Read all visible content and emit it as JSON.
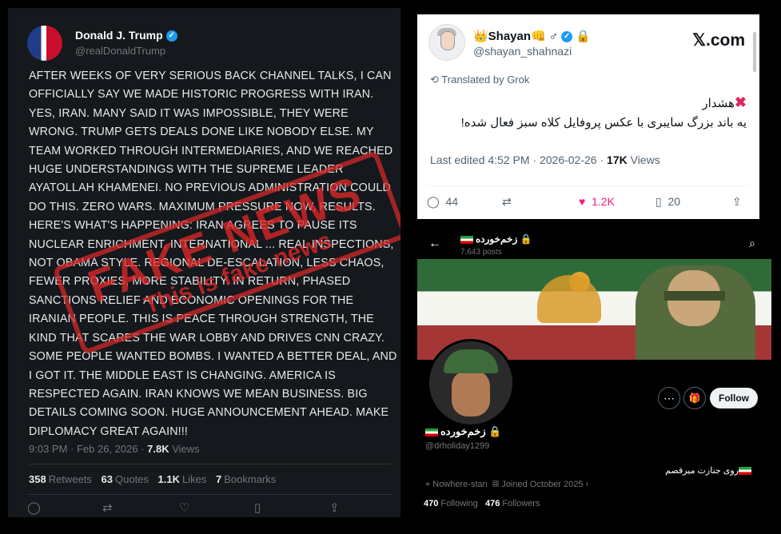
{
  "trump": {
    "name": "Donald J. Trump",
    "handle": "@realDonaldTrump",
    "text": "AFTER WEEKS OF VERY SERIOUS BACK CHANNEL TALKS, I CAN OFFICIALLY SAY WE MADE HISTORIC PROGRESS WITH IRAN. YES, IRAN. MANY SAID IT WAS IMPOSSIBLE, THEY WERE WRONG. TRUMP GETS DEALS DONE LIKE NOBODY ELSE. MY TEAM WORKED THROUGH INTERMEDIARIES, AND WE REACHED HUGE UNDERSTANDINGS WITH THE SUPREME LEADER AYATOLLAH KHAMENEI. NO PREVIOUS ADMINISTRATION COULD DO THIS. ZERO WARS. MAXIMUM PRESSURE NOW, RESULTS. HERE'S WHAT'S HAPPENING: IRAN AGREES TO PAUSE ITS NUCLEAR ENRICHMENT, INTERNATIONAL ... REAL INSPECTIONS, NOT OBAMA STYLE. REGIONAL DE-ESCALATION, LESS CHAOS, FEWER PROXIES, MORE STABILITY. IN RETURN, PHASED SANCTIONS RELIEF AND ECONOMIC OPENINGS FOR THE IRANIAN PEOPLE. THIS IS PEACE THROUGH STRENGTH, THE KIND THAT SCARES THE WAR LOBBY AND DRIVES CNN CRAZY. SOME PEOPLE WANTED BOMBS. I WANTED A BETTER DEAL, AND I GOT IT. THE MIDDLE EAST IS CHANGING. AMERICA IS RESPECTED AGAIN. IRAN KNOWS WE MEAN BUSINESS. BIG DETAILS COMING SOON. HUGE ANNOUNCEMENT AHEAD. MAKE DIPLOMACY GREAT AGAIN!!!",
    "time": "9:03 PM · Feb 26, 2026 · ",
    "views_count": "7.8K",
    "views_label": "Views",
    "retweets_count": "358",
    "retweets_label": "Retweets",
    "quotes_count": "63",
    "quotes_label": "Quotes",
    "likes_count": "1.1K",
    "likes_label": "Likes",
    "bookmarks_count": "7",
    "bookmarks_label": "Bookmarks"
  },
  "stamp": {
    "big": "FAKE NEWS",
    "small": "This is fake news"
  },
  "shayan": {
    "name": "👑Shayan👊 ♂",
    "handle": "@shayan_shahnazi",
    "site": "𝕏.com",
    "translated": "Translated by Grok",
    "line1": "هشدار",
    "line2": "یه باند بزرگ سایبری با عکس پروفایل کلاه سبز فعال شده!",
    "edited": "Last edited 4:52 PM · 2026-02-26 · ",
    "views_count": "17K",
    "views_label": "Views",
    "replies": "44",
    "likes": "1.2K",
    "bookmarks": "20"
  },
  "profile": {
    "title": "زخم‌خورده",
    "posts": "7,643 posts",
    "follow": "Follow",
    "name": "زخم‌خورده",
    "handle": "@drholiday1299",
    "bio": "روی جنازت میرقصم",
    "location": "Nowhere-stan",
    "joined": "Joined October 2025",
    "following_count": "470",
    "following_label": "Following",
    "followers_count": "476",
    "followers_label": "Followers"
  },
  "colors": {
    "twitter_blue": "#1d9bf0",
    "like_pink": "#f91880",
    "stamp_red": "#d22828"
  }
}
